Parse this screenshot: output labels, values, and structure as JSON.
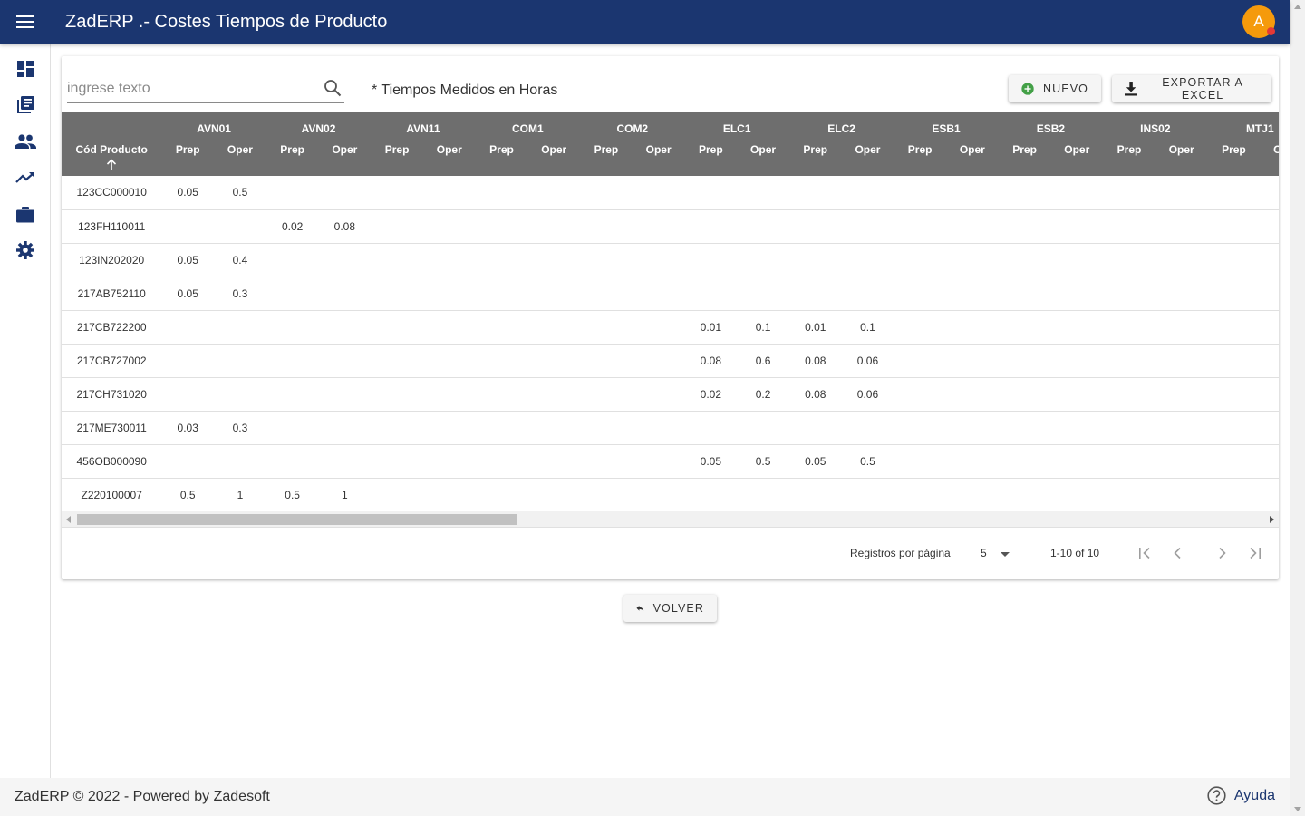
{
  "app": {
    "title": "ZadERP .- Costes Tiempos de Producto",
    "avatar_initial": "A"
  },
  "sidebar": {
    "items": [
      {
        "icon": "dashboard-icon"
      },
      {
        "icon": "library-books-icon"
      },
      {
        "icon": "people-icon"
      },
      {
        "icon": "trending-up-icon"
      },
      {
        "icon": "briefcase-icon"
      },
      {
        "icon": "gear-icon"
      }
    ]
  },
  "search": {
    "placeholder": "ingrese texto",
    "value": ""
  },
  "note": "* Tiempos Medidos en Horas",
  "toolbar": {
    "new_label": "NUEVO",
    "export_label": "EXPORTAR A EXCEL"
  },
  "table": {
    "code_header": "Cód Producto",
    "groups": [
      "AVN01",
      "AVN02",
      "AVN11",
      "COM1",
      "COM2",
      "ELC1",
      "ELC2",
      "ESB1",
      "ESB2",
      "INS02",
      "MTJ1"
    ],
    "sub_labels": [
      "Prep",
      "Oper"
    ],
    "rows": [
      {
        "code": "123CC000010",
        "cells": [
          "0.05",
          "0.5",
          "",
          "",
          "",
          "",
          "",
          "",
          "",
          "",
          "",
          "",
          "",
          "",
          "",
          "",
          "",
          "",
          "",
          "",
          "",
          ""
        ]
      },
      {
        "code": "123FH110011",
        "cells": [
          "",
          "",
          "0.02",
          "0.08",
          "",
          "",
          "",
          "",
          "",
          "",
          "",
          "",
          "",
          "",
          "",
          "",
          "",
          "",
          "",
          "",
          "",
          ""
        ]
      },
      {
        "code": "123IN202020",
        "cells": [
          "0.05",
          "0.4",
          "",
          "",
          "",
          "",
          "",
          "",
          "",
          "",
          "",
          "",
          "",
          "",
          "",
          "",
          "",
          "",
          "",
          "",
          "",
          ""
        ]
      },
      {
        "code": "217AB752110",
        "cells": [
          "0.05",
          "0.3",
          "",
          "",
          "",
          "",
          "",
          "",
          "",
          "",
          "",
          "",
          "",
          "",
          "",
          "",
          "",
          "",
          "",
          "",
          "",
          ""
        ]
      },
      {
        "code": "217CB722200",
        "cells": [
          "",
          "",
          "",
          "",
          "",
          "",
          "",
          "",
          "",
          "",
          "0.01",
          "0.1",
          "0.01",
          "0.1",
          "",
          "",
          "",
          "",
          "",
          "",
          "",
          ""
        ]
      },
      {
        "code": "217CB727002",
        "cells": [
          "",
          "",
          "",
          "",
          "",
          "",
          "",
          "",
          "",
          "",
          "0.08",
          "0.6",
          "0.08",
          "0.06",
          "",
          "",
          "",
          "",
          "",
          "",
          "",
          ""
        ]
      },
      {
        "code": "217CH731020",
        "cells": [
          "",
          "",
          "",
          "",
          "",
          "",
          "",
          "",
          "",
          "",
          "0.02",
          "0.2",
          "0.08",
          "0.06",
          "",
          "",
          "",
          "",
          "",
          "",
          "",
          ""
        ]
      },
      {
        "code": "217ME730011",
        "cells": [
          "0.03",
          "0.3",
          "",
          "",
          "",
          "",
          "",
          "",
          "",
          "",
          "",
          "",
          "",
          "",
          "",
          "",
          "",
          "",
          "",
          "",
          "",
          ""
        ]
      },
      {
        "code": "456OB000090",
        "cells": [
          "",
          "",
          "",
          "",
          "",
          "",
          "",
          "",
          "",
          "",
          "0.05",
          "0.5",
          "0.05",
          "0.5",
          "",
          "",
          "",
          "",
          "",
          "",
          "",
          ""
        ]
      },
      {
        "code": "Z220100007",
        "cells": [
          "0.5",
          "1",
          "0.5",
          "1",
          "",
          "",
          "",
          "",
          "",
          "",
          "",
          "",
          "",
          "",
          "",
          "",
          "",
          "",
          "",
          "",
          "",
          ""
        ]
      }
    ]
  },
  "paginator": {
    "rows_per_page_label": "Registros por página",
    "rows_per_page_value": "5",
    "range_label": "1-10 of 10"
  },
  "back_label": "VOLVER",
  "footer": {
    "text": "ZadERP © 2022 - Powered by Zadesoft",
    "help_label": "Ayuda"
  },
  "colors": {
    "appbar": "#1b3670",
    "table_header": "#6e6e6e",
    "avatar": "#f59a0c",
    "new_icon": "#43a047"
  }
}
